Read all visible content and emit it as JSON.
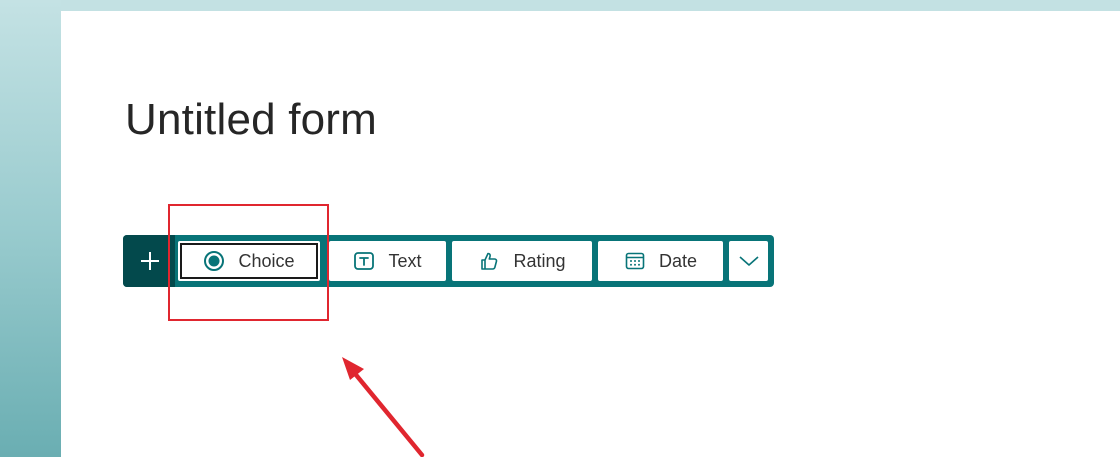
{
  "form": {
    "title": "Untitled form"
  },
  "toolbar": {
    "add_icon": "plus-icon",
    "buttons": [
      {
        "label": "Choice",
        "icon": "radio-button-icon",
        "selected": true
      },
      {
        "label": "Text",
        "icon": "text-box-icon",
        "selected": false
      },
      {
        "label": "Rating",
        "icon": "thumbs-up-icon",
        "selected": false
      },
      {
        "label": "Date",
        "icon": "calendar-icon",
        "selected": false
      }
    ],
    "more_icon": "chevron-down-icon"
  },
  "annotation": {
    "highlight_color": "#e0262f",
    "arrow_color": "#e0262f"
  },
  "colors": {
    "toolbar_bg": "#087478",
    "add_button_bg": "#03494c",
    "accent": "#087478"
  }
}
